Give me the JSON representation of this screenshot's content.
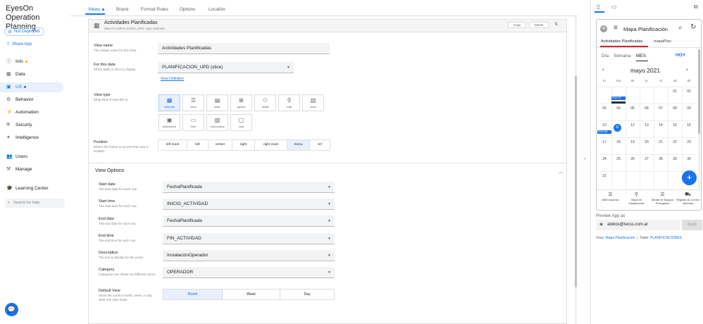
{
  "app": {
    "title": "EyesOn Operation Planning"
  },
  "sidebar": {
    "not_deployed": "Not Deployed",
    "share_app": "Share App",
    "items": [
      {
        "label": "Info",
        "icon": "info-icon",
        "dot": "orange"
      },
      {
        "label": "Data",
        "icon": "data-icon"
      },
      {
        "label": "UX",
        "icon": "ux-icon",
        "dot": "blue",
        "active": true
      },
      {
        "label": "Behavior",
        "icon": "behavior-icon"
      },
      {
        "label": "Automation",
        "icon": "automation-icon"
      },
      {
        "label": "Security",
        "icon": "security-icon"
      },
      {
        "label": "Intelligence",
        "icon": "intelligence-icon"
      },
      {
        "label": "Users",
        "icon": "users-icon"
      },
      {
        "label": "Manage",
        "icon": "manage-icon"
      },
      {
        "label": "Learning Center",
        "icon": "learning-icon"
      }
    ],
    "search_placeholder": "Search for help"
  },
  "tabs": [
    "Views",
    "Brand",
    "Format Rules",
    "Options",
    "Localize"
  ],
  "view_header": {
    "title": "Actividades Planificadas",
    "data_label": "data",
    "data_value": "PLANIFICACION_UPD",
    "type_label": "type",
    "type_value": "calendar",
    "copy": "Copy",
    "delete": "Delete"
  },
  "form": {
    "view_name": {
      "label": "View name",
      "sub": "The unique name for this view.",
      "value": "Actividades Planificadas"
    },
    "for_this_data": {
      "label": "For this data",
      "sub": "Which table or slice to display.",
      "value": "PLANIFICACION_UPD (slice)",
      "link": "View Definition"
    },
    "view_type": {
      "label": "View type",
      "sub": "What kind of view this is.",
      "options": [
        "calendar",
        "deck",
        "table",
        "gallery",
        "detail",
        "map",
        "chart",
        "dashboard",
        "form",
        "onboarding",
        "card"
      ],
      "selected": "calendar"
    },
    "position": {
      "label": "Position",
      "sub": "Where the button to access this view is located.",
      "options": [
        "left most",
        "left",
        "center",
        "right",
        "right most",
        "menu",
        "ref"
      ],
      "selected": "menu"
    }
  },
  "view_options": {
    "title": "View Options",
    "fields": [
      {
        "label": "Start date",
        "sub": "The start date for each row.",
        "value": "FechaPlanificada"
      },
      {
        "label": "Start time",
        "sub": "The start time for each row.",
        "value": "INICIO_ACTIVIDAD"
      },
      {
        "label": "End date",
        "sub": "The end date for each row.",
        "value": "FechaPlanificada"
      },
      {
        "label": "End time",
        "sub": "The end time for each row.",
        "value": "FIN_ACTIVIDAD"
      },
      {
        "label": "Description",
        "sub": "The text to display for the event.",
        "value": "InstalaciónOperador"
      },
      {
        "label": "Category",
        "sub": "Categories are shown as different colors.",
        "value": "OPERADOR"
      }
    ],
    "default_view": {
      "label": "Default View",
      "sub": "Show the current month, week, or day when the view loads.",
      "options": [
        "Month",
        "Week",
        "Day"
      ],
      "selected": "Month"
    }
  },
  "preview": {
    "app_title": "Mapa Planificación",
    "tabs": [
      "Actividades Planificadas",
      "mapaPlan"
    ],
    "cal_modes": [
      "Día",
      "Semana",
      "MES"
    ],
    "today_btn": "HOY",
    "month": "mayo 2021",
    "weekdays": [
      "lu",
      "ma",
      "mi",
      "ju",
      "vi",
      "sá",
      "do"
    ],
    "weeks": [
      [
        "",
        "",
        "",
        "",
        "",
        "01",
        "02"
      ],
      [
        "03",
        "04",
        "05",
        "06",
        "07",
        "08",
        "09"
      ],
      [
        "10",
        "11",
        "12",
        "13",
        "14",
        "15",
        "16"
      ],
      [
        "17",
        "18",
        "19",
        "20",
        "21",
        "22",
        "23"
      ],
      [
        "24",
        "25",
        "26",
        "27",
        "28",
        "29",
        "30"
      ],
      [
        "31",
        "",
        "",
        "",
        "",
        "",
        ""
      ]
    ],
    "today": "11",
    "events": [
      "EOH-277",
      "EOH-248"
    ],
    "nav": [
      {
        "label": "ABM Usuarios",
        "icon": "list-icon"
      },
      {
        "label": "Mapa de Instalaciones",
        "icon": "map-pin-icon"
      },
      {
        "label": "Detalle de Equipos Entregados",
        "icon": "list-icon"
      },
      {
        "label": "Registro de Control Vehicular",
        "icon": "car-icon"
      }
    ],
    "preview_as_label": "Preview App as",
    "user_email": "alobos@tecss.com.ar",
    "apply": "Apply",
    "view_info": {
      "view_label": "View:",
      "view_name": "Mapa Planificación",
      "sep": "|",
      "table_label": "Table:",
      "table_name": "PLANIFICACIONES"
    }
  }
}
